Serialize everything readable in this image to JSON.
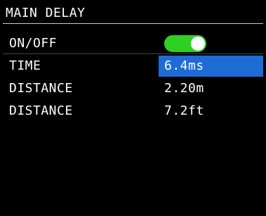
{
  "title": "MAIN DELAY",
  "accent_color": "#1e6bd6",
  "toggle_on_color": "#2ed11f",
  "rows": [
    {
      "label": "ON/OFF",
      "toggle_state": "on"
    },
    {
      "label": "TIME",
      "value": "6.4ms",
      "selected": true
    },
    {
      "label": "DISTANCE",
      "value": "2.20m"
    },
    {
      "label": "DISTANCE",
      "value": "7.2ft"
    }
  ]
}
